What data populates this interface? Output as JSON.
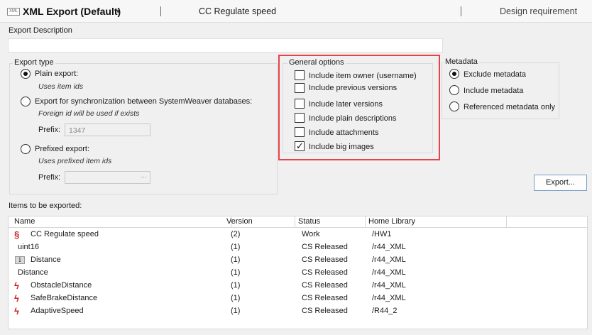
{
  "header": {
    "icon_text": "XML",
    "title": "XML Export (Default)",
    "breadcrumb": "CC Regulate speed",
    "item_type": "Design requirement"
  },
  "export_description": {
    "label": "Export Description",
    "value": ""
  },
  "export_type": {
    "title": "Export type",
    "plain": {
      "label": "Plain export:",
      "hint": "Uses item ids",
      "checked": true
    },
    "sync": {
      "label": "Export for synchronization between SystemWeaver databases:",
      "hint": "Foreign id will be used if exists",
      "prefix_label": "Prefix:",
      "prefix_value": "1347"
    },
    "prefixed": {
      "label": "Prefixed export:",
      "hint": "Uses prefixed item ids",
      "prefix_label": "Prefix:",
      "prefix_value": "",
      "ellipsis": "..."
    }
  },
  "general_options": {
    "title": "General options",
    "items": [
      {
        "label": "Include item owner (username)",
        "checked": false
      },
      {
        "label": "Include previous versions",
        "checked": false
      },
      {
        "label": "Include later versions",
        "checked": false
      },
      {
        "label": "Include plain descriptions",
        "checked": false
      },
      {
        "label": "Include attachments",
        "checked": false
      },
      {
        "label": "Include big images",
        "checked": true
      }
    ]
  },
  "metadata": {
    "title": "Metadata",
    "options": [
      {
        "label": "Exclude metadata",
        "checked": true
      },
      {
        "label": "Include metadata",
        "checked": false
      },
      {
        "label": "Referenced metadata only",
        "checked": false
      }
    ]
  },
  "export_button": "Export...",
  "items": {
    "label": "Items to be exported:",
    "columns": [
      "Name",
      "Version",
      "Status",
      "Home Library"
    ],
    "rows": [
      {
        "icon": "requirement-s-icon",
        "name": "CC Regulate speed",
        "version": "(2)",
        "status": "Work",
        "library": "/HW1"
      },
      {
        "icon": "",
        "name": "uint16",
        "version": "(1)",
        "status": "CS Released",
        "library": "/r44_XML"
      },
      {
        "icon": "info-item-icon",
        "name": "Distance",
        "version": "(1)",
        "status": "CS Released",
        "library": "/r44_XML"
      },
      {
        "icon": "",
        "name": "Distance",
        "version": "(1)",
        "status": "CS Released",
        "library": "/r44_XML"
      },
      {
        "icon": "signal-bolt-icon",
        "name": "ObstacleDistance",
        "version": "(1)",
        "status": "CS Released",
        "library": "/r44_XML"
      },
      {
        "icon": "signal-bolt-icon",
        "name": "SafeBrakeDistance",
        "version": "(1)",
        "status": "CS Released",
        "library": "/r44_XML"
      },
      {
        "icon": "signal-bolt-icon",
        "name": "AdaptiveSpeed",
        "version": "(1)",
        "status": "CS Released",
        "library": "/R44_2"
      }
    ]
  }
}
